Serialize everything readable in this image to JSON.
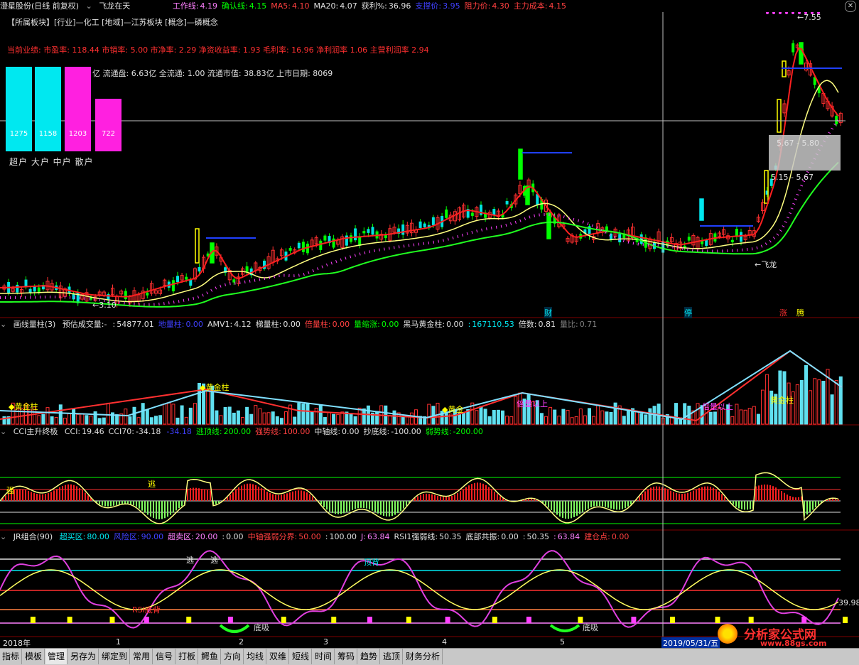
{
  "header": {
    "stock": "澄星股份(日线 前复权)",
    "indicator": "飞龙在天",
    "items": [
      {
        "label": "工作线:",
        "value": "4.19",
        "color": "#ff80ff"
      },
      {
        "label": "确认线:",
        "value": "4.15",
        "color": "#00ff00"
      },
      {
        "label": "MA5:",
        "value": "4.10",
        "color": "#ff4040"
      },
      {
        "label": "MA20:",
        "value": "4.07",
        "color": "#e0e0e0"
      },
      {
        "label": "获利%:",
        "value": "36.96",
        "color": "#e0e0e0"
      },
      {
        "label": "支撑价:",
        "value": "3.95",
        "color": "#4040ff"
      },
      {
        "label": "阻力价:",
        "value": "4.30",
        "color": "#ff4040"
      },
      {
        "label": "主力成本:",
        "value": "4.15",
        "color": "#ff4040"
      }
    ]
  },
  "info": {
    "line1": "【所属板块】[行业]—化工 [地域]—江苏板块 [概念]—磷概念",
    "line2": "当前业绩: 市盈率: 118.44 市销率: 5.00 市净率: 2.29 净资收益率: 1.93 毛利率: 16.96 净利润率 1.06 主营利润率 2.94",
    "line3": "亿 流通盘: 6.63亿 全流通: 1.00 流通市值: 38.83亿 上市日期: 8069"
  },
  "money_bars": [
    {
      "label": "超户",
      "value": "1275",
      "color": "#00e8f0",
      "height": 0.93
    },
    {
      "label": "大户",
      "value": "1158",
      "color": "#00e8f0",
      "height": 0.93
    },
    {
      "label": "中户",
      "value": "1203",
      "color": "#ff20e0",
      "height": 0.93
    },
    {
      "label": "散户",
      "value": "722",
      "color": "#ff20e0",
      "height": 0.58
    }
  ],
  "money_labels": "超户 大户 中户 散户",
  "price_labels": {
    "high": "←7.55",
    "low": "←3.10",
    "range1": "5.67 - 5.80",
    "range2": "5.15 - 5.67",
    "feilong": "←飞龙",
    "tag_caizhi": "财",
    "tag_ting": "停",
    "tag_zhang": "涨",
    "tag_teng": "腾"
  },
  "vol_header": {
    "title": "画线量柱(3)",
    "items": [
      {
        "label": "预估成交量:-",
        "value": "",
        "color": "#e0e0e0"
      },
      {
        "label": ":",
        "value": "54877.01",
        "color": "#e0e0e0"
      },
      {
        "label": "地量柱:",
        "value": "0.00",
        "color": "#4040ff"
      },
      {
        "label": "AMV1:",
        "value": "4.12",
        "color": "#e0e0e0"
      },
      {
        "label": "梯量柱:",
        "value": "0.00",
        "color": "#e0e0e0"
      },
      {
        "label": "倍量柱:",
        "value": "0.00",
        "color": "#ff4040"
      },
      {
        "label": "量缩涨:",
        "value": "0.00",
        "color": "#00ff00"
      },
      {
        "label": "黑马黄金柱:",
        "value": "0.00",
        "color": "#e0e0e0"
      },
      {
        "label": ":",
        "value": "167110.53",
        "color": "#00e8f0"
      },
      {
        "label": "倍数:",
        "value": "0.81",
        "color": "#e0e0e0"
      },
      {
        "label": "量比:",
        "value": "0.71",
        "color": "#808080"
      }
    ],
    "labels": {
      "gold1": "◆黄金柱",
      "gold2": "◆黄金柱",
      "gold3": "◆黄金",
      "gold4": "黄金柱",
      "dbl1": "倍量以上",
      "dbl2": "倍量以上"
    }
  },
  "cci_header": {
    "title": "CCI主升终极",
    "items": [
      {
        "label": "CCI:",
        "value": "19.46",
        "color": "#e0e0e0"
      },
      {
        "label": "CCI70:",
        "value": "-34.18",
        "color": "#e0e0e0"
      },
      {
        "label": "",
        "value": "-34.18",
        "color": "#4040ff"
      },
      {
        "label": "逃顶线:",
        "value": "200.00",
        "color": "#00ff00"
      },
      {
        "label": "强势线:",
        "value": "100.00",
        "color": "#ff4040"
      },
      {
        "label": "中轴线:",
        "value": "0.00",
        "color": "#e0e0e0"
      },
      {
        "label": "抄底线:",
        "value": "-100.00",
        "color": "#e0e0e0"
      },
      {
        "label": "弱势线:",
        "value": "-200.00",
        "color": "#00ff00"
      }
    ],
    "mark_qiang": "强",
    "mark_tao": "逃"
  },
  "jr_header": {
    "title": "JR组合(90)",
    "items": [
      {
        "label": "超买区:",
        "value": "80.00",
        "color": "#00e8f0"
      },
      {
        "label": "风险区:",
        "value": "90.00",
        "color": "#4040ff"
      },
      {
        "label": "超卖区:",
        "value": "20.00",
        "color": "#ff80ff"
      },
      {
        "label": ":",
        "value": "0.00",
        "color": "#e0e0e0"
      },
      {
        "label": "中轴强弱分界:",
        "value": "50.00",
        "color": "#ff4040"
      },
      {
        "label": ":",
        "value": "100.00",
        "color": "#e0e0e0"
      },
      {
        "label": "J:",
        "value": "63.84",
        "color": "#ff80ff"
      },
      {
        "label": "RSI1强弱线:",
        "value": "50.35",
        "color": "#e0e0e0"
      },
      {
        "label": "底部共振:",
        "value": "0.00",
        "color": "#e0e0e0"
      },
      {
        "label": ":",
        "value": "50.35",
        "color": "#e0e0e0"
      },
      {
        "label": ":",
        "value": "63.84",
        "color": "#ff80ff"
      },
      {
        "label": "建仓点:",
        "value": "0.00",
        "color": "#ff4040"
      }
    ],
    "right_value": "39.98",
    "rsi_bottom": "RSI底背",
    "dixi": "底吸",
    "tao": "逃",
    "taoding": "顶背"
  },
  "timeline": {
    "labels": [
      "2018年",
      "1",
      "2",
      "3",
      "4",
      "5"
    ],
    "cursor_date": "2019/05/31/五"
  },
  "watermark": {
    "title": "分析家公式网",
    "url": "www.88gs.com"
  },
  "tabs": [
    "指标",
    "模板",
    "管理",
    "另存为",
    "绑定到",
    "常用",
    "信号",
    "打板",
    "鳄鱼",
    "方向",
    "均线",
    "双维",
    "短线",
    "时间",
    "筹码",
    "趋势",
    "逃顶",
    "财务分析"
  ]
}
